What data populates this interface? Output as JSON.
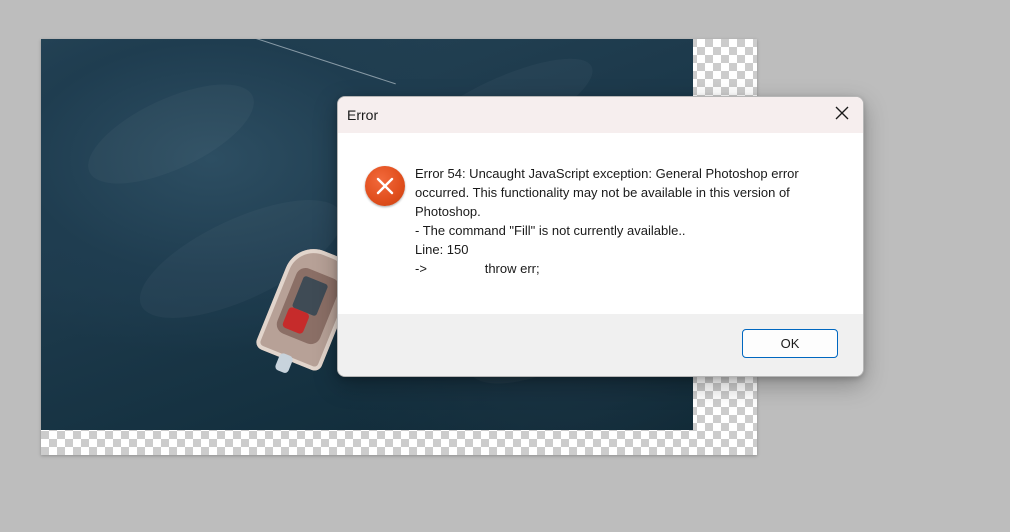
{
  "dialog": {
    "title": "Error",
    "close_icon": "close-icon",
    "error_icon": "error-x-circle-icon",
    "message_lines": [
      "Error 54: Uncaught JavaScript exception: General Photoshop error occurred. This functionality may not be available in this version of Photoshop.",
      "- The command \"Fill\" is not currently available..",
      "Line: 150",
      "->                throw err;"
    ],
    "ok_label": "OK"
  },
  "canvas": {
    "image_subject": "boat on dark water",
    "transparency_pattern": "checkerboard"
  },
  "colors": {
    "accent": "#0067c0",
    "error_icon": "#e2501f",
    "title_bar": "#f6eeee",
    "workspace": "#bdbdbd"
  }
}
